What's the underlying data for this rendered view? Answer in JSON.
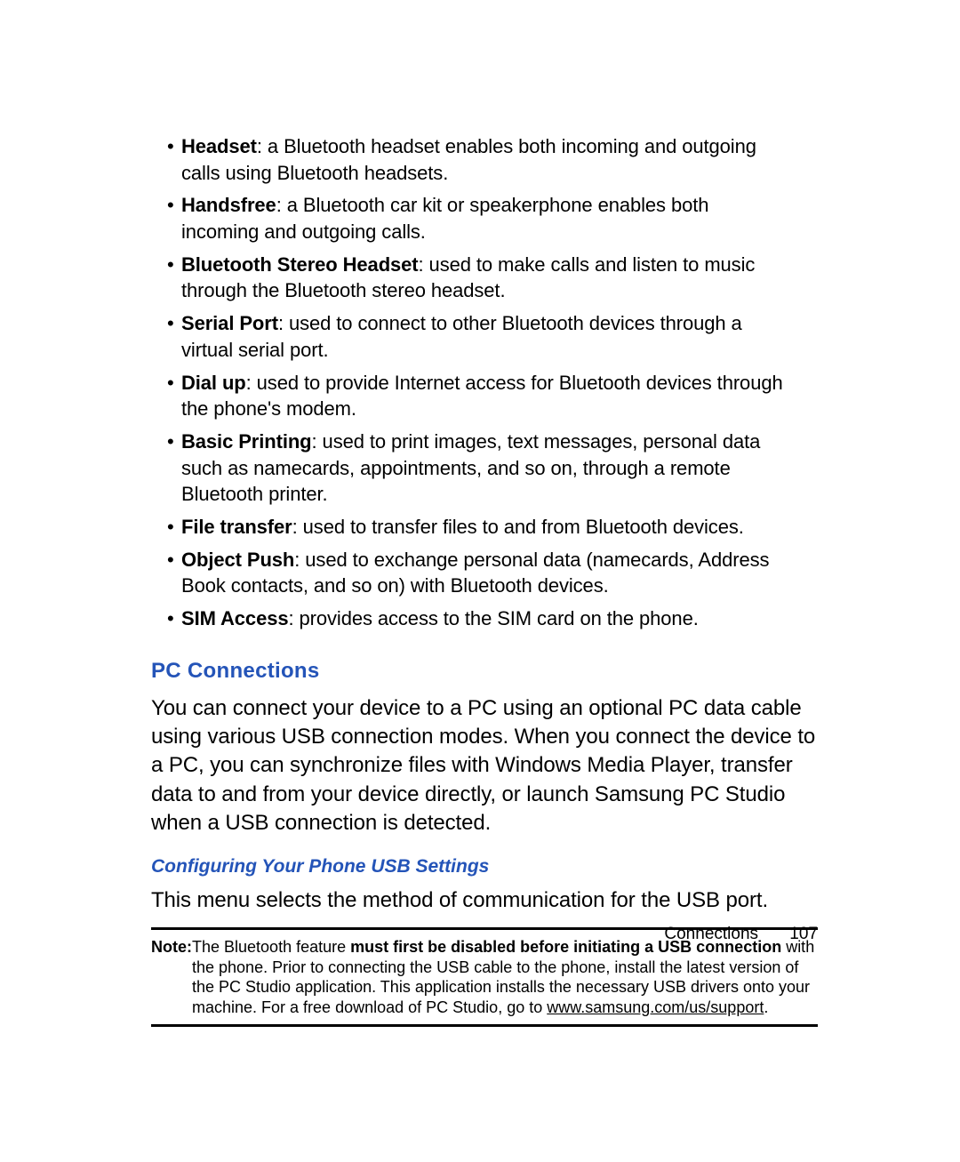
{
  "bullets": [
    {
      "term": "Headset",
      "text": ": a Bluetooth headset enables both incoming and outgoing calls using Bluetooth headsets."
    },
    {
      "term": "Handsfree",
      "text": ": a Bluetooth car kit or speakerphone enables both incoming and outgoing calls."
    },
    {
      "term": "Bluetooth Stereo Headset",
      "text": ": used to make calls and listen to music through the Bluetooth stereo headset."
    },
    {
      "term": "Serial Port",
      "text": ": used to connect to other Bluetooth devices through a virtual serial port."
    },
    {
      "term": "Dial up",
      "text": ": used to provide Internet access for Bluetooth devices through the phone's modem."
    },
    {
      "term": "Basic Printing",
      "text": ": used to print images, text messages, personal data such as namecards, appointments, and so on, through a remote Bluetooth printer."
    },
    {
      "term": "File transfer",
      "text": ": used to transfer files to and from Bluetooth devices."
    },
    {
      "term": "Object Push",
      "text": ": used to exchange personal data (namecards, Address Book contacts, and so on) with Bluetooth devices."
    },
    {
      "term": "SIM Access",
      "text": ": provides access to the SIM card on the phone."
    }
  ],
  "section_heading": "PC Connections",
  "section_body": "You can connect your device to a PC using an optional PC data cable using various USB connection modes. When you connect the device to a PC, you can synchronize files with Windows Media Player, transfer data to and from your device directly, or launch Samsung PC Studio when a USB connection is detected.",
  "subheading": "Configuring Your Phone USB Settings",
  "sub_body": "This menu selects the method of communication for the USB port.",
  "note": {
    "label": "Note:",
    "pre": "The Bluetooth feature ",
    "bold": "must first be disabled before initiating a USB connection",
    "post": " with the phone. Prior to connecting the USB cable to the phone, install the latest version of the PC Studio application. This application installs the necessary USB drivers onto your machine. For a free download of PC Studio, go to ",
    "link": "www.samsung.com/us/support",
    "end": "."
  },
  "footer": {
    "chapter": "Connections",
    "page": "107"
  }
}
